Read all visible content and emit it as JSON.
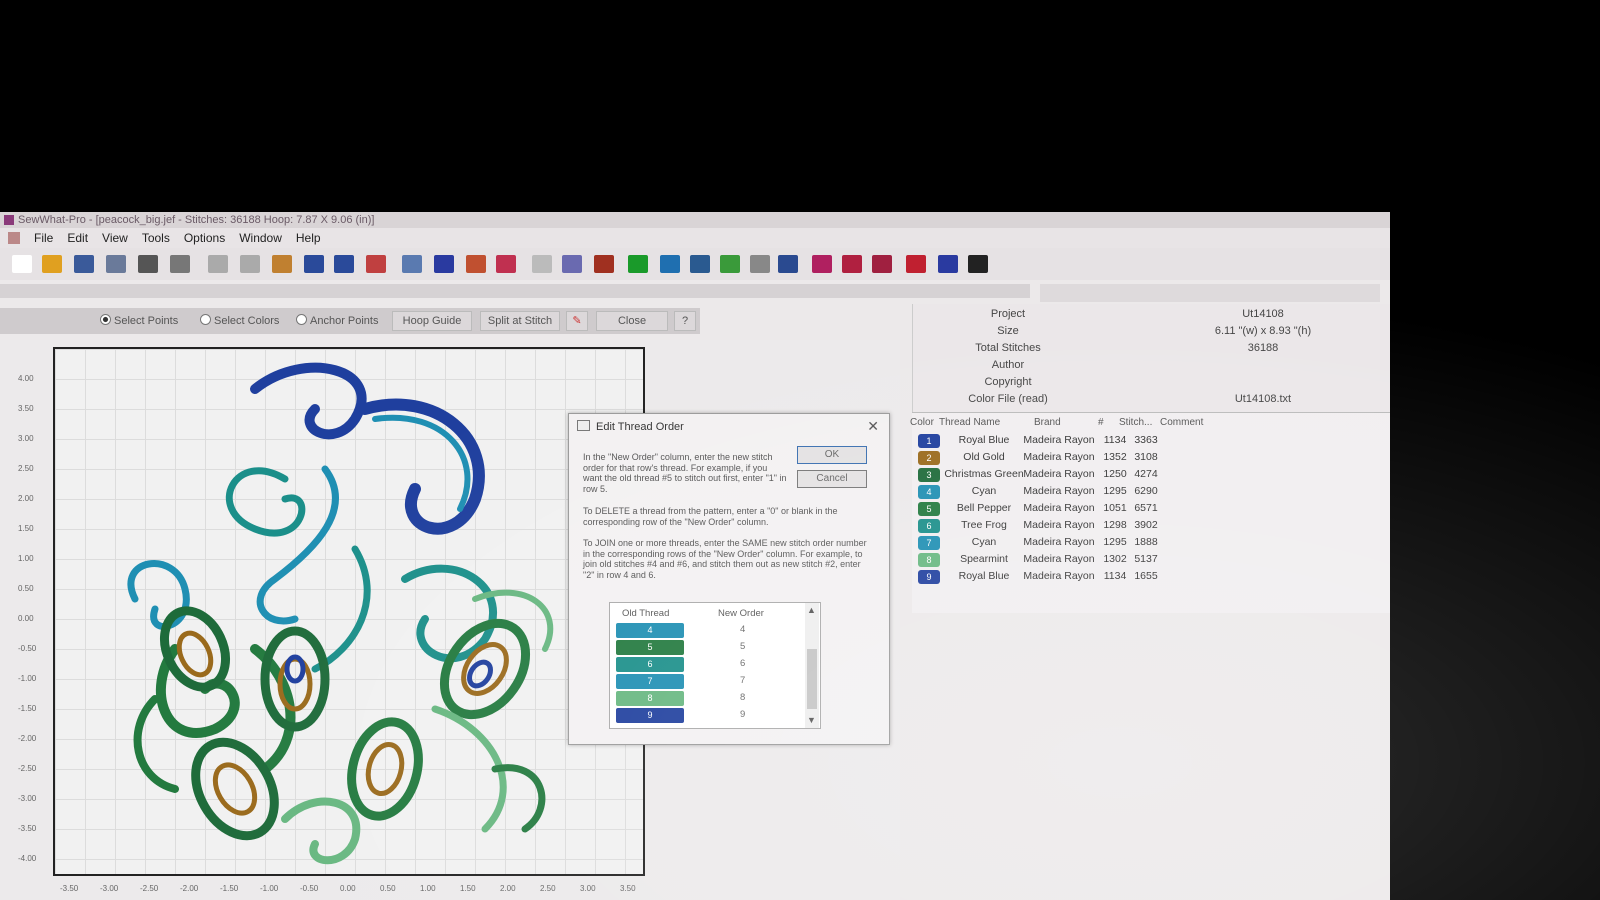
{
  "window": {
    "title": "SewWhat-Pro - [peacock_big.jef - Stitches: 36188  Hoop: 7.87 X 9.06 (in)]"
  },
  "menu": [
    "File",
    "Edit",
    "View",
    "Tools",
    "Options",
    "Window",
    "Help"
  ],
  "toolbar_icons": [
    "new-icon",
    "open-icon",
    "save-icon",
    "save-as-icon",
    "print-icon",
    "preview-icon",
    "cut-icon",
    "copy-icon",
    "paste-icon",
    "undo-icon",
    "redo-icon",
    "hoop-icon",
    "ruler-icon",
    "text-b-icon",
    "text-a-icon",
    "stitch-icon",
    "blank-icon",
    "grid-icon",
    "film-icon",
    "color-icon",
    "shirt-icon",
    "frame-icon",
    "palette-icon",
    "thread-icon",
    "needle-icon",
    "flower-icon",
    "cars-icon",
    "cars2-icon",
    "plus-icon",
    "help-icon",
    "pointer-help-icon"
  ],
  "edit_bar": {
    "select_points": "Select Points",
    "select_colors": "Select Colors",
    "anchor_points": "Anchor Points",
    "hoop_guide": "Hoop Guide",
    "split_at_stitch": "Split at Stitch",
    "close": "Close"
  },
  "ruler_y": [
    "4.00",
    "3.50",
    "3.00",
    "2.50",
    "2.00",
    "1.50",
    "1.00",
    "0.50",
    "0.00",
    "-0.50",
    "-1.00",
    "-1.50",
    "-2.00",
    "-2.50",
    "-3.00",
    "-3.50",
    "-4.00"
  ],
  "ruler_x": [
    "-3.50",
    "-3.00",
    "-2.50",
    "-2.00",
    "-1.50",
    "-1.00",
    "-0.50",
    "0.00",
    "0.50",
    "1.00",
    "1.50",
    "2.00",
    "2.50",
    "3.00",
    "3.50"
  ],
  "project_info": [
    {
      "label": "Project",
      "value": "Ut14108"
    },
    {
      "label": "Size",
      "value": "6.11 \"(w) x 8.93 \"(h)"
    },
    {
      "label": "Total Stitches",
      "value": "36188"
    },
    {
      "label": "Author",
      "value": ""
    },
    {
      "label": "Copyright",
      "value": ""
    },
    {
      "label": "Color File (read)",
      "value": "Ut14108.txt"
    }
  ],
  "thread_table": {
    "headers": [
      "Color",
      "Thread Name",
      "Brand",
      "#",
      "Stitch...",
      "Comment"
    ],
    "rows": [
      {
        "n": "1",
        "color": "#1f3f9e",
        "name": "Royal Blue",
        "brand": "Madeira Rayon",
        "num": "1134",
        "stitches": "3363"
      },
      {
        "n": "2",
        "color": "#9a6a1c",
        "name": "Old Gold",
        "brand": "Madeira Rayon",
        "num": "1352",
        "stitches": "3108"
      },
      {
        "n": "3",
        "color": "#1e6b3a",
        "name": "Christmas Green",
        "brand": "Madeira Rayon",
        "num": "1250",
        "stitches": "4274"
      },
      {
        "n": "4",
        "color": "#1f8fb3",
        "name": "Cyan",
        "brand": "Madeira Rayon",
        "num": "1295",
        "stitches": "6290"
      },
      {
        "n": "5",
        "color": "#237a3f",
        "name": "Bell Pepper",
        "brand": "Madeira Rayon",
        "num": "1051",
        "stitches": "6571"
      },
      {
        "n": "6",
        "color": "#1b8f8a",
        "name": "Tree Frog",
        "brand": "Madeira Rayon",
        "num": "1298",
        "stitches": "3902"
      },
      {
        "n": "7",
        "color": "#1f8fb3",
        "name": "Cyan",
        "brand": "Madeira Rayon",
        "num": "1295",
        "stitches": "1888"
      },
      {
        "n": "8",
        "color": "#67b780",
        "name": "Spearmint",
        "brand": "Madeira Rayon",
        "num": "1302",
        "stitches": "5137"
      },
      {
        "n": "9",
        "color": "#1f3f9e",
        "name": "Royal Blue",
        "brand": "Madeira Rayon",
        "num": "1134",
        "stitches": "1655"
      }
    ]
  },
  "dialog": {
    "title": "Edit Thread Order",
    "ok": "OK",
    "cancel": "Cancel",
    "para1": "In the \"New Order\" column, enter the new stitch order for that row's thread. For example, if you want the old thread #5 to stitch out first, enter \"1\" in row 5.",
    "para2": "To DELETE a thread from the pattern, enter a \"0\" or blank in the corresponding row of the \"New Order\" column.",
    "para3": "To JOIN one or more threads, enter the SAME new stitch order number in the corresponding rows of the \"New Order\" column. For example, to join old stitches #4 and #6, and stitch them out as new stitch #2, enter \"2\" in row 4 and 6.",
    "col_old": "Old Thread",
    "col_new": "New Order",
    "rows": [
      {
        "old": "4",
        "color": "#1f8fb3",
        "new": "4"
      },
      {
        "old": "5",
        "color": "#237a3f",
        "new": "5"
      },
      {
        "old": "6",
        "color": "#1b8f8a",
        "new": "6"
      },
      {
        "old": "7",
        "color": "#1f8fb3",
        "new": "7"
      },
      {
        "old": "8",
        "color": "#67b780",
        "new": "8"
      },
      {
        "old": "9",
        "color": "#1f3f9e",
        "new": "9"
      }
    ]
  }
}
